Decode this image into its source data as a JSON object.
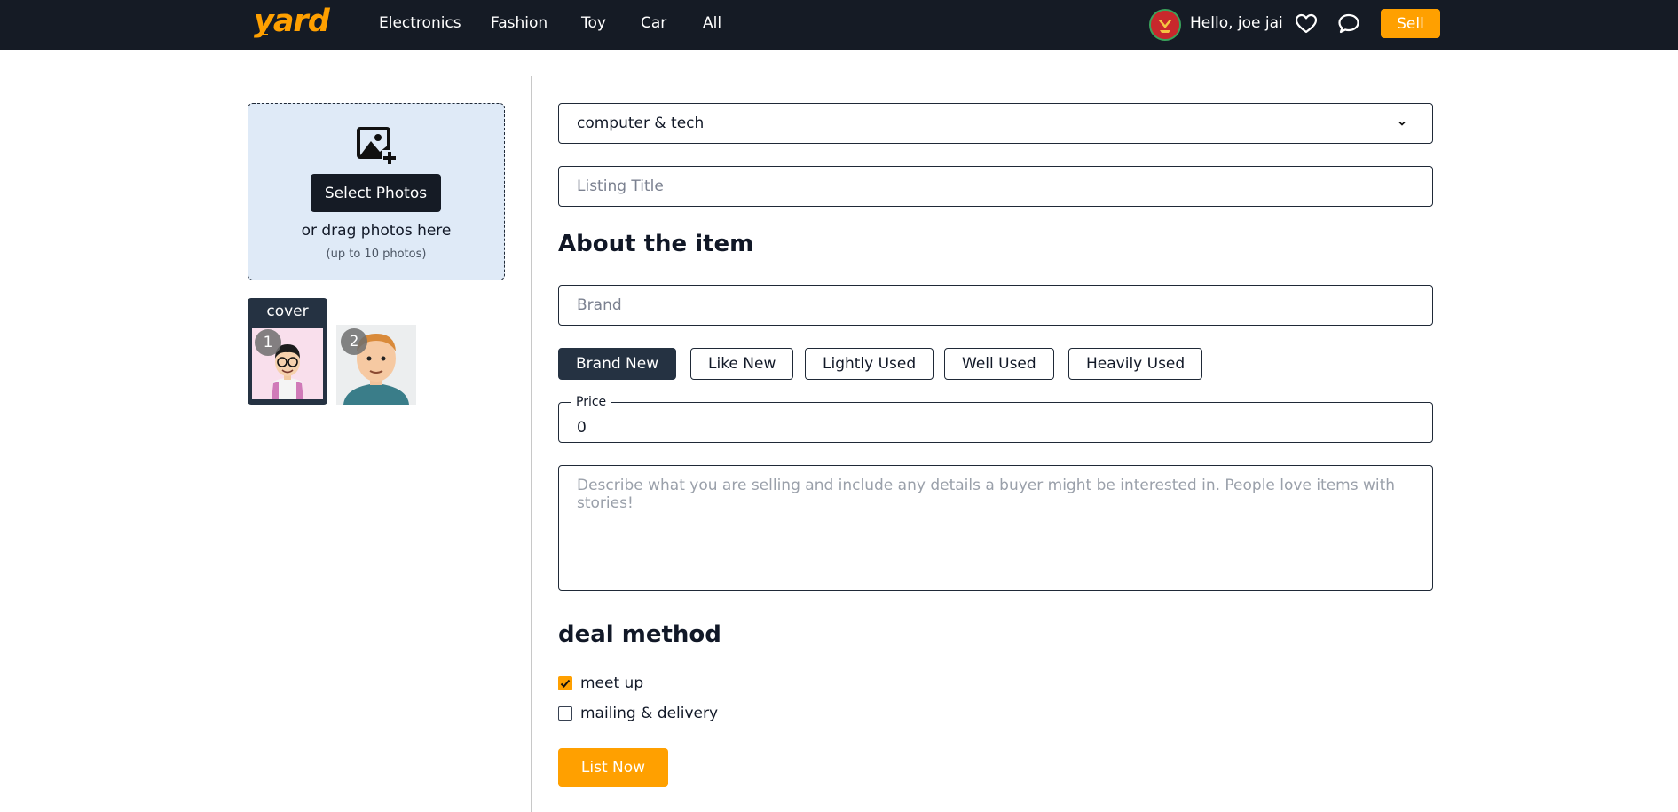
{
  "header": {
    "logo": "yard",
    "nav": [
      "Electronics",
      "Fashion",
      "Toy",
      "Car",
      "All"
    ],
    "greeting": "Hello, joe jai",
    "sell_label": "Sell",
    "icons": [
      "avatar",
      "heart-icon",
      "chat-icon"
    ]
  },
  "upload": {
    "button_label": "Select Photos",
    "drag_text": "or drag photos here",
    "limit_text": "(up to 10 photos)",
    "cover_label": "cover",
    "thumbnails": [
      {
        "number": "1",
        "is_cover": true
      },
      {
        "number": "2",
        "is_cover": false
      }
    ]
  },
  "form": {
    "category_value": "computer & tech",
    "title_placeholder": "Listing Title",
    "about_heading": "About the item",
    "brand_placeholder": "Brand",
    "conditions": [
      "Brand New",
      "Like New",
      "Lightly Used",
      "Well Used",
      "Heavily Used"
    ],
    "selected_condition": "Brand New",
    "price_label": "Price",
    "price_value": "0",
    "description_placeholder": "Describe what you are selling and include any details a buyer might be interested in. People love items with stories!",
    "deal_heading": "deal method",
    "deal_options": [
      {
        "label": "meet up",
        "checked": true
      },
      {
        "label": "mailing & delivery",
        "checked": false
      }
    ],
    "submit_label": "List Now"
  },
  "colors": {
    "accent": "#ffa000",
    "header_bg": "#151b25",
    "dark_button": "#253242",
    "dropzone_bg": "#dfeaf7"
  }
}
